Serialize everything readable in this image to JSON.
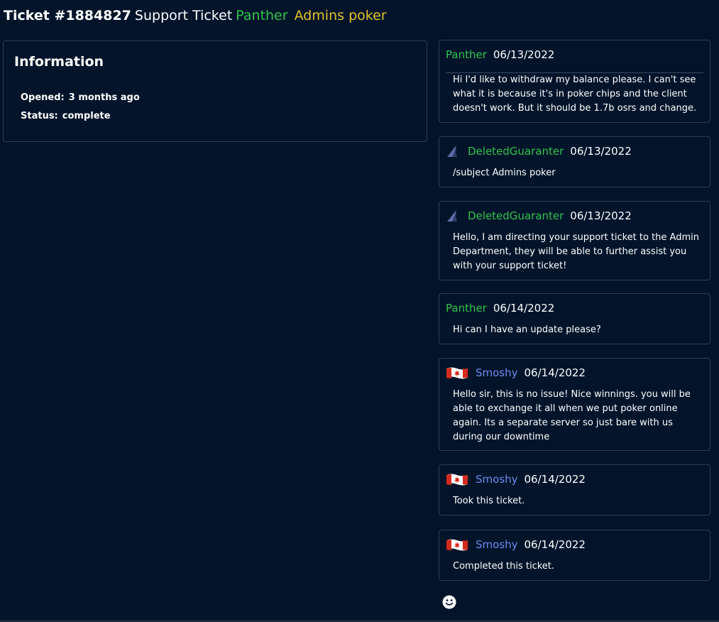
{
  "header": {
    "ticket_id": "Ticket #1884827",
    "type": "Support Ticket",
    "user": "Panther",
    "subject": "Admins poker"
  },
  "information": {
    "heading": "Information",
    "opened_label": "Opened:",
    "opened_value": "3 months ago",
    "status_label": "Status:",
    "status_value": "complete"
  },
  "messages": [
    {
      "author": "Panther",
      "date": "06/13/2022",
      "body": "Hi I'd like to withdraw my balance please. I can't see what it is because it's in poker chips and the client doesn't work. But it should be 1.7b osrs and change.",
      "name_color": "#2fc44f",
      "avatar": "none"
    },
    {
      "author": "DeletedGuaranter",
      "date": "06/13/2022",
      "body": "/subject Admins poker",
      "name_color": "#2fc44f",
      "avatar": "shark-fin-icon"
    },
    {
      "author": "DeletedGuaranter",
      "date": "06/13/2022",
      "body": "Hello, I am directing your support ticket to the Admin Department, they will be able to further assist you with your support ticket!",
      "name_color": "#2fc44f",
      "avatar": "shark-fin-icon"
    },
    {
      "author": "Panther",
      "date": "06/14/2022",
      "body": "Hi can I have an update please?",
      "name_color": "#2fc44f",
      "avatar": "none"
    },
    {
      "author": "Smoshy",
      "date": "06/14/2022",
      "body": "Hello sir, this is no issue! Nice winnings. you will be able to exchange it all when we put poker online again. Its a separate server so just bare with us during our downtime",
      "name_color": "#6a8cf0",
      "avatar": "canada-flag-icon"
    },
    {
      "author": "Smoshy",
      "date": "06/14/2022",
      "body": "Took this ticket.",
      "name_color": "#6a8cf0",
      "avatar": "canada-flag-icon"
    },
    {
      "author": "Smoshy",
      "date": "06/14/2022",
      "body": "Completed this ticket.",
      "name_color": "#6a8cf0",
      "avatar": "canada-flag-icon"
    }
  ],
  "colors": {
    "background": "#02142a",
    "border": "#2e3e53",
    "user_green": "#2fc44f",
    "staff_blue": "#6a8cf0",
    "subject_yellow": "#e6c12a"
  },
  "reaction_icon": "smiley-icon"
}
